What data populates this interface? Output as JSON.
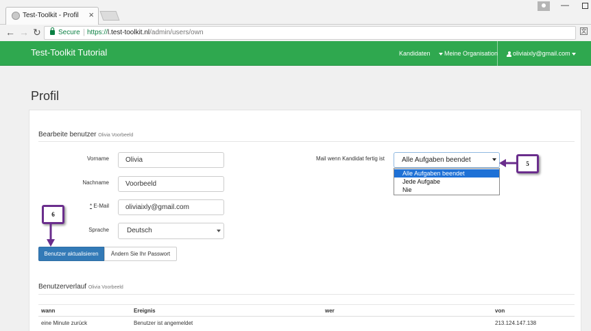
{
  "browser": {
    "tab_title": "Test-Toolkit - Profil",
    "tab_close": "×",
    "secure_label": "Secure",
    "url_scheme": "https://",
    "url_host": "l.test-toolkit.nl",
    "url_path": "/admin/users/own"
  },
  "navbar": {
    "brand": "Test-Toolkit Tutorial",
    "links": [
      "Kandidaten",
      "Meine Organisation"
    ],
    "user_email": "oliviaixly@gmail.com",
    "color": "#2fa84f"
  },
  "page": {
    "title": "Profil"
  },
  "edit_section": {
    "title": "Bearbeite benutzer",
    "subtitle": "Olivia Voorbeeld",
    "fields": {
      "firstname_label": "Vorname",
      "firstname_value": "Olivia",
      "lastname_label": "Nachname",
      "lastname_value": "Voorbeeld",
      "email_label": "E-Mail",
      "email_required": "*",
      "email_value": "oliviaixly@gmail.com",
      "language_label": "Sprache",
      "language_value": "Deutsch"
    },
    "mail_label": "Mail wenn Kandidat fertig ist",
    "mail_value": "Alle Aufgaben beendet",
    "mail_options": [
      "Alle Aufgaben beendet",
      "Jede Aufgabe",
      "Nie"
    ],
    "save_button": "Benutzer aktualisieren",
    "password_button": "Ändern Sie Ihr Passwort"
  },
  "callouts": {
    "five": "5",
    "six": "6",
    "color": "#6a2d8c"
  },
  "history": {
    "title": "Benutzerverlauf",
    "subtitle": "Olivia Voorbeeld",
    "columns": [
      "wann",
      "Ereignis",
      "wer",
      "von"
    ],
    "rows": [
      [
        "eine Minute zurück",
        "Benutzer ist angemeldet",
        "",
        "213.124.147.138"
      ]
    ]
  }
}
